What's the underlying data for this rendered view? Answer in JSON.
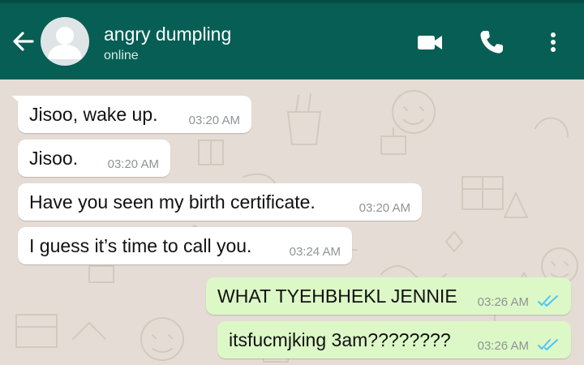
{
  "header": {
    "contact_name": "angry dumpling",
    "status": "online",
    "icons": {
      "back": "arrow-back-icon",
      "avatar": "default-avatar-icon",
      "video": "video-call-icon",
      "voice": "voice-call-icon",
      "menu": "more-vert-icon"
    }
  },
  "colors": {
    "appbar": "#075e54",
    "status_strip": "#054d44",
    "wallpaper": "#e5ddd5",
    "incoming_bubble": "#ffffff",
    "outgoing_bubble": "#dcf8c6",
    "read_ticks": "#4fc3f7"
  },
  "messages": [
    {
      "direction": "incoming",
      "text": "Jisoo, wake up.",
      "time": "03:20 AM"
    },
    {
      "direction": "incoming",
      "text": "Jisoo.",
      "time": "03:20 AM"
    },
    {
      "direction": "incoming",
      "text": "Have you seen my birth certificate.",
      "time": "03:20 AM"
    },
    {
      "direction": "incoming",
      "text": "I guess it’s time to call you.",
      "time": "03:24 AM"
    },
    {
      "direction": "outgoing",
      "text": "WHAT TYEHBHEKL JENNIE",
      "time": "03:26 AM",
      "status": "read"
    },
    {
      "direction": "outgoing",
      "text": "itsfucmjking 3am????????",
      "time": "03:26 AM",
      "status": "read"
    }
  ]
}
